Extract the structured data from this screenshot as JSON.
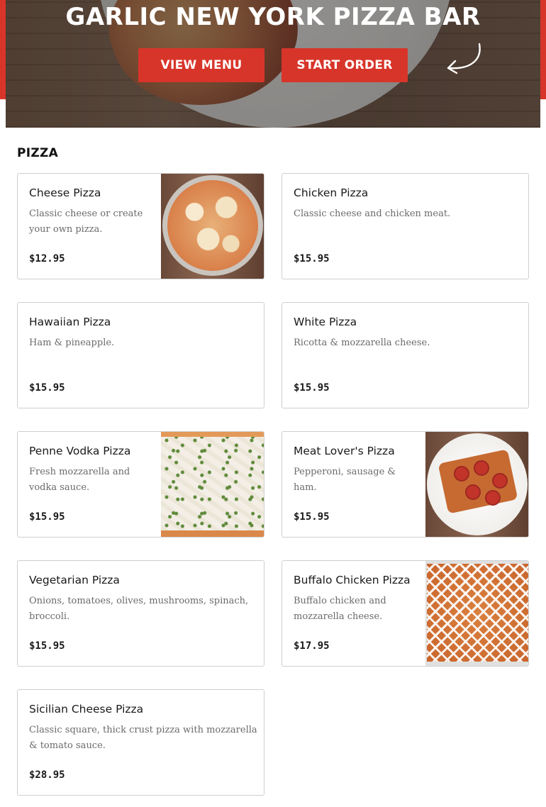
{
  "hero": {
    "title": "GARLIC NEW YORK PIZZA BAR",
    "view_menu_label": "VIEW MENU",
    "start_order_label": "START ORDER"
  },
  "section": {
    "title": "PIZZA"
  },
  "items": [
    {
      "name": "Cheese Pizza",
      "description": "Classic cheese or create your own pizza.",
      "price": "$12.95",
      "image": "cheese-pizza-photo"
    },
    {
      "name": "Chicken Pizza",
      "description": "Classic cheese and chicken meat.",
      "price": "$15.95"
    },
    {
      "name": "Hawaiian Pizza",
      "description": "Ham & pineapple.",
      "price": "$15.95"
    },
    {
      "name": "White Pizza",
      "description": "Ricotta & mozzarella cheese.",
      "price": "$15.95"
    },
    {
      "name": "Penne Vodka Pizza",
      "description": "Fresh mozzarella and vodka sauce.",
      "price": "$15.95",
      "image": "penne-vodka-pizza-photo"
    },
    {
      "name": "Meat Lover's Pizza",
      "description": "Pepperoni, sausage & ham.",
      "price": "$15.95",
      "image": "meat-lovers-pizza-photo"
    },
    {
      "name": "Vegetarian Pizza",
      "description": "Onions, tomatoes, olives, mushrooms, spinach, broccoli.",
      "price": "$15.95"
    },
    {
      "name": "Buffalo Chicken Pizza",
      "description": "Buffalo chicken and mozzarella cheese.",
      "price": "$17.95",
      "image": "buffalo-chicken-pizza-photo"
    },
    {
      "name": "Sicilian Cheese Pizza",
      "description": "Classic square, thick crust pizza with mozzarella & tomato sauce.",
      "price": "$28.95"
    }
  ],
  "colors": {
    "brand_red": "#d8352a",
    "text_dark": "#1a1a1a",
    "text_muted": "#6a6a6a",
    "card_border": "#cfcfcf"
  }
}
